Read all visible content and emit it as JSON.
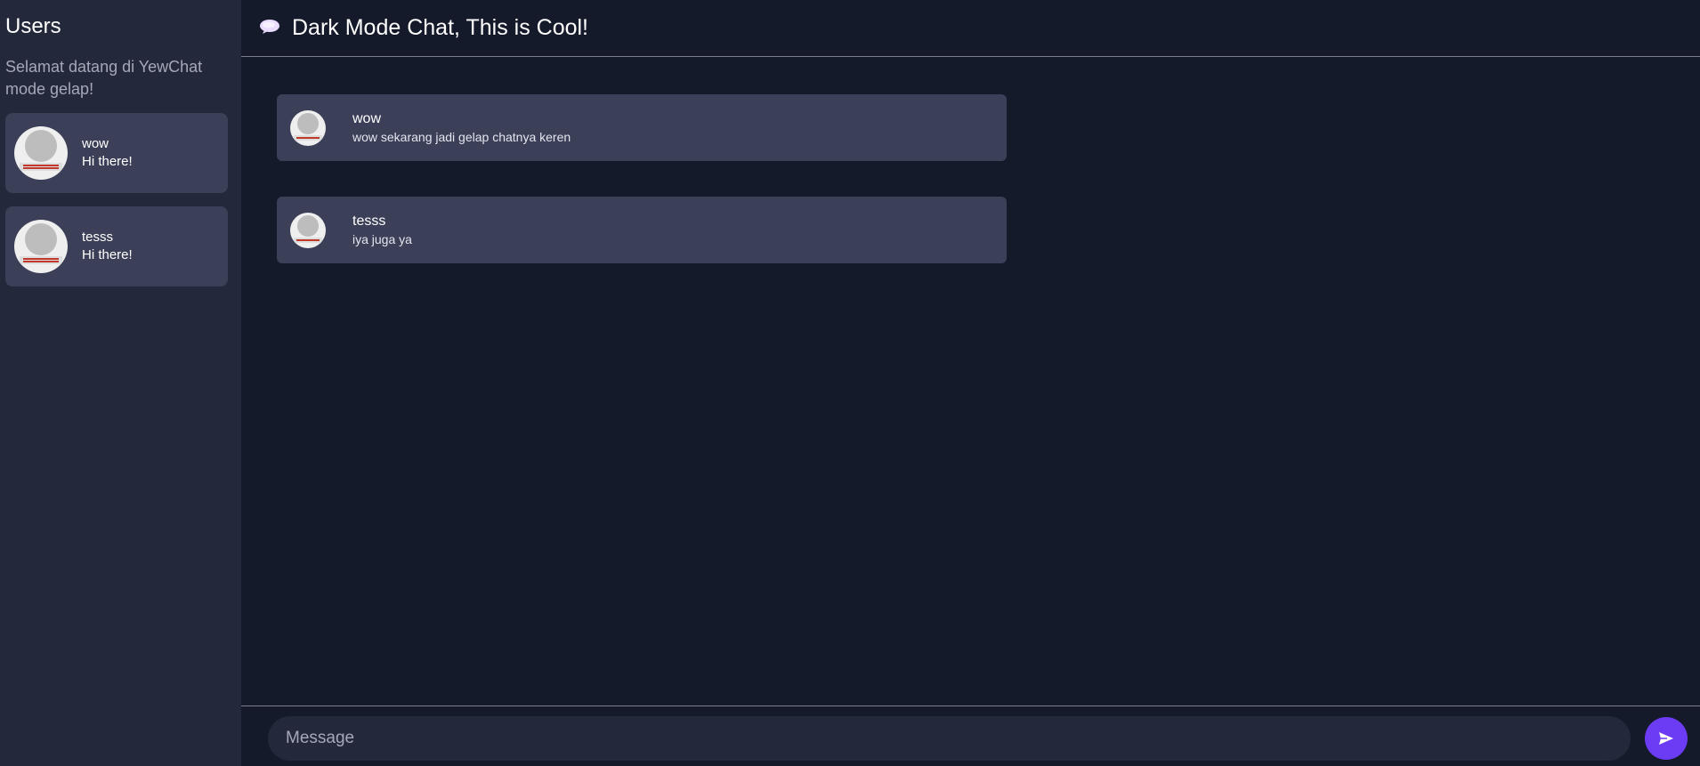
{
  "sidebar": {
    "title": "Users",
    "subtitle": "Selamat datang di YewChat mode gelap!",
    "users": [
      {
        "name": "wow",
        "status": "Hi there!"
      },
      {
        "name": "tesss",
        "status": "Hi there!"
      }
    ]
  },
  "header": {
    "icon": "speech-bubble-icon",
    "title": "Dark Mode Chat, This is Cool!"
  },
  "messages": [
    {
      "sender": "wow",
      "text": "wow sekarang jadi gelap chatnya keren"
    },
    {
      "sender": "tesss",
      "text": "iya juga ya"
    }
  ],
  "composer": {
    "placeholder": "Message",
    "send_icon": "send-icon"
  },
  "colors": {
    "background": "#151a2b",
    "sidebar": "#23283b",
    "card": "#3b3f57",
    "accent": "#6c3cf5"
  }
}
